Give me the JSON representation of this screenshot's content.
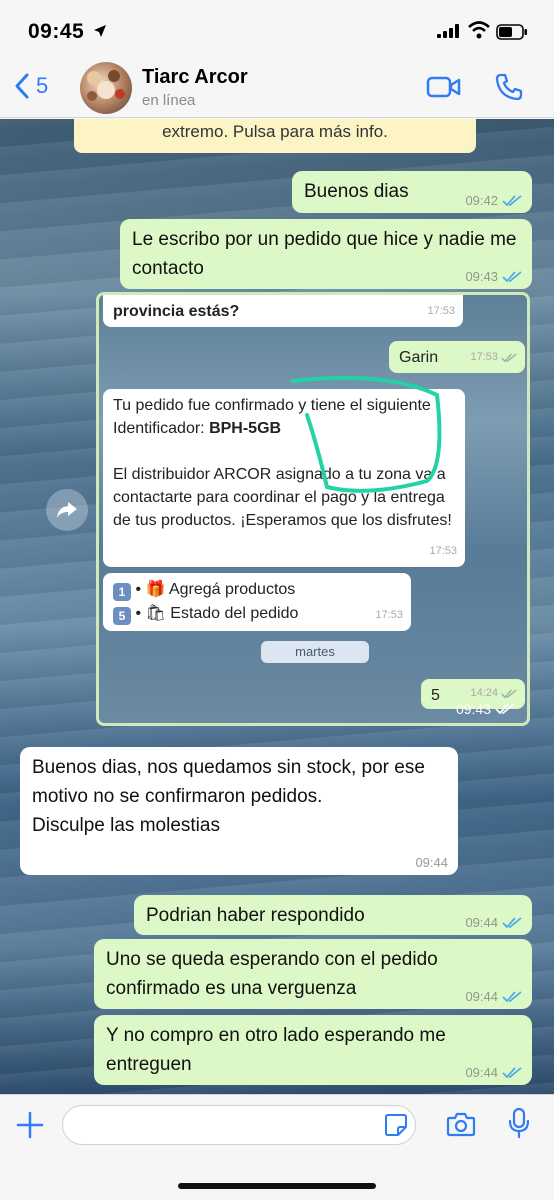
{
  "status_bar": {
    "time": "09:45"
  },
  "header": {
    "back_count": "5",
    "contact_name": "Tiarc Arcor",
    "contact_status": "en línea"
  },
  "system_note": {
    "text": "extremo. Pulsa para más info."
  },
  "messages": {
    "m1": {
      "text": "Buenos dias",
      "time": "09:42"
    },
    "m2": {
      "text": "Le escribo por un pedido que hice y nadie me contacto",
      "time": "09:43"
    },
    "image_time": "09:43",
    "m3": {
      "text": "Buenos dias, nos quedamos sin stock, por ese motivo no se confirmaron pedidos.\nDisculpe las molestias",
      "time": "09:44"
    },
    "m4": {
      "text": "Podrian haber respondido",
      "time": "09:44"
    },
    "m5": {
      "text": "Uno se queda esperando con el pedido confirmado es una verguenza",
      "time": "09:44"
    },
    "m6": {
      "text": "Y no compro en otro lado esperando me entreguen",
      "time": "09:44"
    }
  },
  "screenshot": {
    "q": {
      "text": "provincia estás?",
      "time": "17:53"
    },
    "garin": {
      "text": "Garin",
      "time": "17:53"
    },
    "confirm": {
      "line1": "Tu pedido fue confirmado y tiene el siguiente Identificador: ",
      "id": "BPH-5GB",
      "line2": "El distribuidor ARCOR asignado a tu zona va a contactarte para coordinar el pago y la entrega de tus productos. ¡Esperamos que los disfrutes!",
      "time": "17:53"
    },
    "menu": {
      "opt1_num": "1",
      "opt1": "Agregá productos",
      "opt2_num": "5",
      "opt2": "Estado del pedido",
      "time": "17:53"
    },
    "day": "martes",
    "five": {
      "text": "5",
      "time": "14:24"
    }
  },
  "colors": {
    "outgoing_bubble": "#dcf8c6",
    "incoming_bubble": "#ffffff",
    "accent": "#2f7cf6",
    "read_ticks": "#4fa8e6",
    "highlight_circle": "#22d3a5"
  }
}
